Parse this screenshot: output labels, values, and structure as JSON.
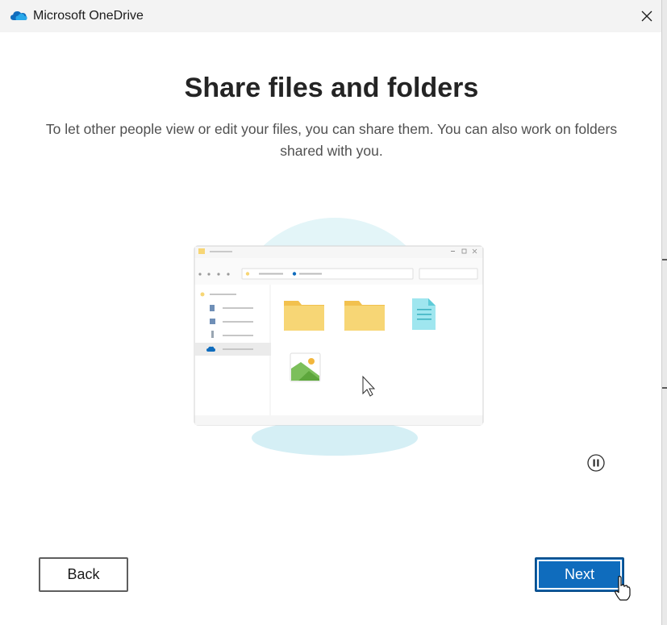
{
  "window": {
    "title": "Microsoft OneDrive",
    "app_icon": "onedrive-cloud-icon",
    "close_icon": "close-icon"
  },
  "page": {
    "heading": "Share files and folders",
    "description": "To let other people view or edit your files, you can share them. You can also work on folders shared with you."
  },
  "illustration": {
    "icons": [
      "folder-icon",
      "folder-icon",
      "document-icon",
      "image-icon",
      "mouse-pointer-icon",
      "onedrive-cloud-icon"
    ]
  },
  "controls": {
    "pause_icon": "pause-icon",
    "back_label": "Back",
    "next_label": "Next"
  },
  "colors": {
    "accent": "#0f6cbd",
    "folder": "#f7d675",
    "title_bar": "#f3f3f3"
  }
}
